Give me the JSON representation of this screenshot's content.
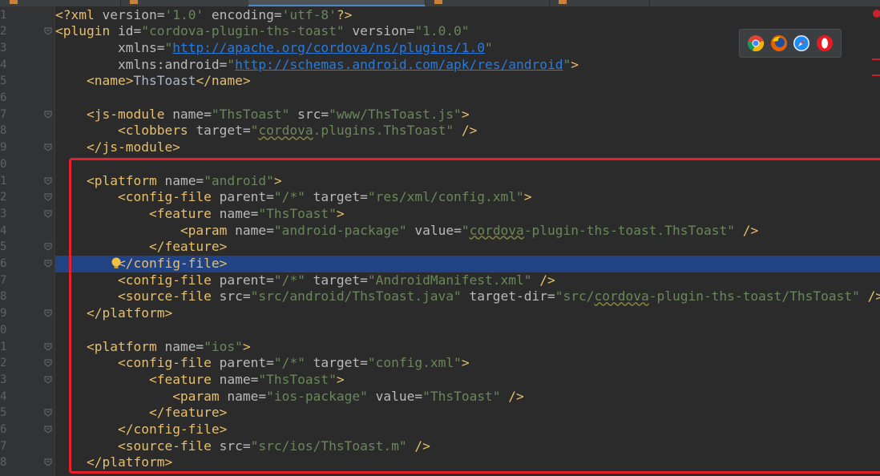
{
  "editor": {
    "lines": [
      {
        "ln": "1",
        "tokens": [
          [
            "pi",
            "<?xml "
          ],
          [
            "attr",
            "version="
          ],
          [
            "val",
            "'1.0'"
          ],
          [
            "attr",
            " encoding="
          ],
          [
            "val",
            "'utf-8'"
          ],
          [
            "pi",
            "?>"
          ]
        ]
      },
      {
        "ln": "2",
        "tokens": [
          [
            "tag",
            "<plugin "
          ],
          [
            "attr",
            "id="
          ],
          [
            "val",
            "\"cordova-plugin-ths-toast\""
          ],
          [
            "attr",
            " version="
          ],
          [
            "val",
            "\"1.0.0\""
          ]
        ]
      },
      {
        "ln": "3",
        "tokens": [
          [
            "txt",
            "        "
          ],
          [
            "attr",
            "xmlns="
          ],
          [
            "val",
            "\""
          ],
          [
            "url",
            "http://apache.org/cordova/ns/plugins/1.0"
          ],
          [
            "val",
            "\""
          ]
        ]
      },
      {
        "ln": "4",
        "tokens": [
          [
            "txt",
            "        "
          ],
          [
            "attr",
            "xmlns:android="
          ],
          [
            "val",
            "\""
          ],
          [
            "url",
            "http://schemas.android.com/apk/res/android"
          ],
          [
            "val",
            "\""
          ],
          [
            "tag",
            ">"
          ]
        ]
      },
      {
        "ln": "5",
        "tokens": [
          [
            "txt",
            "    "
          ],
          [
            "tag",
            "<name>"
          ],
          [
            "txt",
            "ThsToast"
          ],
          [
            "tag",
            "</name>"
          ]
        ]
      },
      {
        "ln": "6",
        "tokens": [
          [
            "txt",
            ""
          ]
        ]
      },
      {
        "ln": "7",
        "tokens": [
          [
            "txt",
            "    "
          ],
          [
            "tag",
            "<js-module "
          ],
          [
            "attr",
            "name="
          ],
          [
            "val",
            "\"ThsToast\""
          ],
          [
            "attr",
            " src="
          ],
          [
            "val",
            "\"www/ThsToast.js\""
          ],
          [
            "tag",
            ">"
          ]
        ]
      },
      {
        "ln": "8",
        "tokens": [
          [
            "txt",
            "        "
          ],
          [
            "tag",
            "<clobbers "
          ],
          [
            "attr",
            "target="
          ],
          [
            "val",
            "\""
          ],
          [
            "squig",
            "cordova"
          ],
          [
            "val",
            ".plugins.ThsToast\""
          ],
          [
            "tag",
            " />"
          ]
        ]
      },
      {
        "ln": "9",
        "tokens": [
          [
            "txt",
            "    "
          ],
          [
            "tag",
            "</js-module>"
          ]
        ]
      },
      {
        "ln": "0",
        "tokens": [
          [
            "txt",
            ""
          ]
        ]
      },
      {
        "ln": "1",
        "tokens": [
          [
            "txt",
            "    "
          ],
          [
            "tag",
            "<platform "
          ],
          [
            "attr",
            "name="
          ],
          [
            "val",
            "\"android\""
          ],
          [
            "tag",
            ">"
          ]
        ]
      },
      {
        "ln": "2",
        "tokens": [
          [
            "txt",
            "        "
          ],
          [
            "tag",
            "<config-file "
          ],
          [
            "attr",
            "parent="
          ],
          [
            "val",
            "\"/*\""
          ],
          [
            "attr",
            " target="
          ],
          [
            "val",
            "\"res/xml/config.xml\""
          ],
          [
            "tag",
            ">"
          ]
        ]
      },
      {
        "ln": "3",
        "tokens": [
          [
            "txt",
            "            "
          ],
          [
            "tag",
            "<feature "
          ],
          [
            "attr",
            "name="
          ],
          [
            "val",
            "\"ThsToast\""
          ],
          [
            "tag",
            ">"
          ]
        ]
      },
      {
        "ln": "4",
        "tokens": [
          [
            "txt",
            "                "
          ],
          [
            "tag",
            "<param "
          ],
          [
            "attr",
            "name="
          ],
          [
            "val",
            "\"android-package\""
          ],
          [
            "attr",
            " value="
          ],
          [
            "val",
            "\""
          ],
          [
            "squig",
            "cordova"
          ],
          [
            "val",
            "-plugin-ths-toast.ThsToast\""
          ],
          [
            "tag",
            " />"
          ]
        ]
      },
      {
        "ln": "5",
        "tokens": [
          [
            "txt",
            "            "
          ],
          [
            "tag",
            "</feature>"
          ]
        ]
      },
      {
        "ln": "6",
        "highlight": true,
        "tokens": [
          [
            "txt",
            "        "
          ],
          [
            "tag",
            "</config-file>"
          ]
        ]
      },
      {
        "ln": "7",
        "tokens": [
          [
            "txt",
            "        "
          ],
          [
            "tag",
            "<config-file "
          ],
          [
            "attr",
            "parent="
          ],
          [
            "val",
            "\"/*\""
          ],
          [
            "attr",
            " target="
          ],
          [
            "val",
            "\"AndroidManifest.xml\""
          ],
          [
            "tag",
            " />"
          ]
        ]
      },
      {
        "ln": "8",
        "tokens": [
          [
            "txt",
            "        "
          ],
          [
            "tag",
            "<source-file "
          ],
          [
            "attr",
            "src="
          ],
          [
            "val",
            "\"src/android/ThsToast.java\""
          ],
          [
            "attr",
            " target-dir="
          ],
          [
            "val",
            "\"src/"
          ],
          [
            "squig",
            "cordova"
          ],
          [
            "val",
            "-plugin-ths-toast/ThsToast\""
          ],
          [
            "tag",
            " />"
          ]
        ]
      },
      {
        "ln": "9",
        "tokens": [
          [
            "txt",
            "    "
          ],
          [
            "tag",
            "</platform>"
          ]
        ]
      },
      {
        "ln": "0",
        "tokens": [
          [
            "txt",
            ""
          ]
        ]
      },
      {
        "ln": "1",
        "tokens": [
          [
            "txt",
            "    "
          ],
          [
            "tag",
            "<platform "
          ],
          [
            "attr",
            "name="
          ],
          [
            "val",
            "\"ios\""
          ],
          [
            "tag",
            ">"
          ]
        ]
      },
      {
        "ln": "2",
        "tokens": [
          [
            "txt",
            "        "
          ],
          [
            "tag",
            "<config-file "
          ],
          [
            "attr",
            "parent="
          ],
          [
            "val",
            "\"/*\""
          ],
          [
            "attr",
            " target="
          ],
          [
            "val",
            "\"config.xml\""
          ],
          [
            "tag",
            ">"
          ]
        ]
      },
      {
        "ln": "3",
        "tokens": [
          [
            "txt",
            "            "
          ],
          [
            "tag",
            "<feature "
          ],
          [
            "attr",
            "name="
          ],
          [
            "val",
            "\"ThsToast\""
          ],
          [
            "tag",
            ">"
          ]
        ]
      },
      {
        "ln": "4",
        "tokens": [
          [
            "txt",
            "               "
          ],
          [
            "tag",
            "<param "
          ],
          [
            "attr",
            "name="
          ],
          [
            "val",
            "\"ios-package\""
          ],
          [
            "attr",
            " value="
          ],
          [
            "val",
            "\"ThsToast\""
          ],
          [
            "tag",
            " />"
          ]
        ]
      },
      {
        "ln": "5",
        "tokens": [
          [
            "txt",
            "            "
          ],
          [
            "tag",
            "</feature>"
          ]
        ]
      },
      {
        "ln": "6",
        "tokens": [
          [
            "txt",
            "        "
          ],
          [
            "tag",
            "</config-file>"
          ]
        ]
      },
      {
        "ln": "7",
        "tokens": [
          [
            "txt",
            "        "
          ],
          [
            "tag",
            "<source-file "
          ],
          [
            "attr",
            "src="
          ],
          [
            "val",
            "\"src/ios/ThsToast.m\""
          ],
          [
            "tag",
            " />"
          ]
        ]
      },
      {
        "ln": "8",
        "tokens": [
          [
            "txt",
            "    "
          ],
          [
            "tag",
            "</platform>"
          ]
        ]
      }
    ],
    "fold_lines": [
      2,
      7,
      9,
      11,
      12,
      13,
      15,
      16,
      19,
      21,
      22,
      23,
      25,
      26,
      28
    ],
    "colors": {
      "selection": "#214283",
      "annotation_box": "#e8202a"
    }
  },
  "browser_icons": [
    "chrome-icon",
    "firefox-icon",
    "safari-icon",
    "opera-icon"
  ]
}
